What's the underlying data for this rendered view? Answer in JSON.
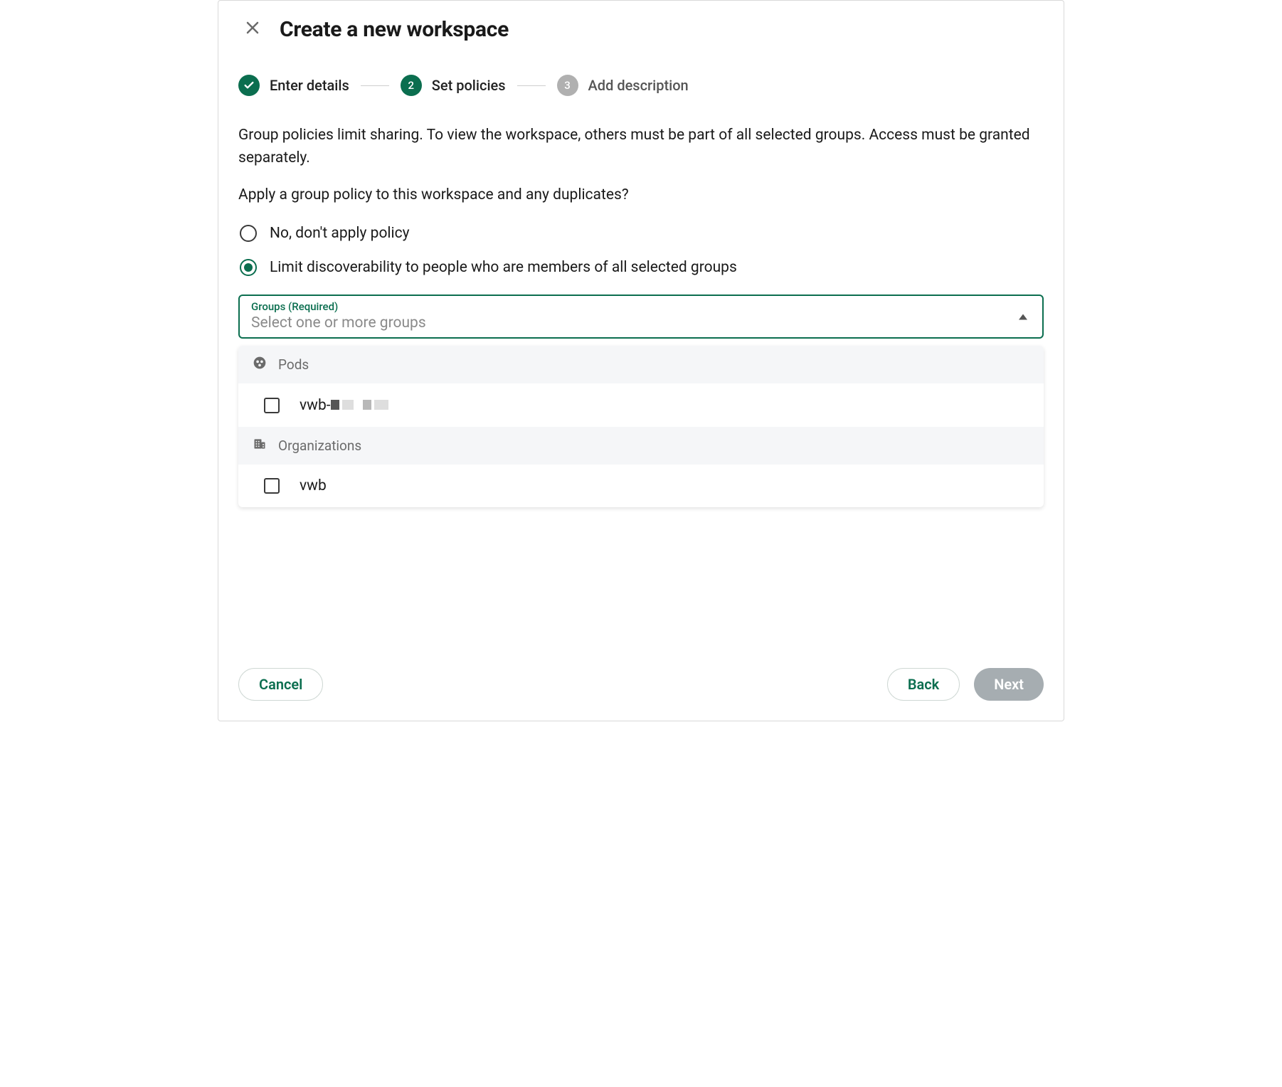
{
  "dialog": {
    "title": "Create a new workspace"
  },
  "stepper": {
    "step1": {
      "label": "Enter details",
      "state": "completed"
    },
    "step2": {
      "label": "Set policies",
      "number": "2",
      "state": "active"
    },
    "step3": {
      "label": "Add description",
      "number": "3",
      "state": "inactive"
    }
  },
  "body": {
    "info": "Group policies limit sharing. To view the workspace, others must be part of all selected groups. Access must be granted separately.",
    "question": "Apply a group policy to this workspace and any duplicates?",
    "options": {
      "no_policy": "No, don't apply policy",
      "limit": "Limit discoverability to people who are members of all selected groups"
    },
    "groups_field": {
      "label": "Groups (Required)",
      "placeholder": "Select one or more groups"
    },
    "dropdown": {
      "section1": {
        "header": "Pods",
        "item1": "vwb-"
      },
      "section2": {
        "header": "Organizations",
        "item1": "vwb"
      }
    }
  },
  "footer": {
    "cancel": "Cancel",
    "back": "Back",
    "next": "Next"
  }
}
